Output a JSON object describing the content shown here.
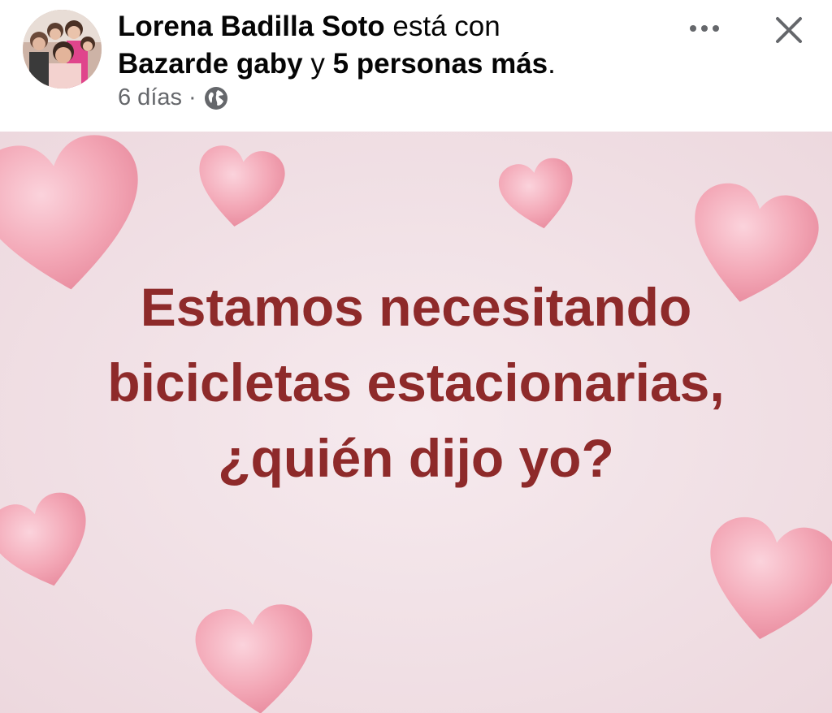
{
  "post": {
    "author": "Lorena Badilla Soto",
    "with_text": "está con",
    "tagged": "Bazarde gaby",
    "connector": "y",
    "others": "5 personas más",
    "period": ".",
    "time": "6 días",
    "separator": "·",
    "privacy_icon": "globe-icon",
    "image_text": "Estamos necesitando bicicletas estacionarias, ¿quién dijo yo?"
  },
  "icons": {
    "more": "more-options-icon",
    "close": "close-icon"
  },
  "colors": {
    "text_primary": "#050505",
    "text_secondary": "#65676b",
    "image_bg": "#f1e2e6",
    "image_text": "#8e2a2a",
    "heart": "#f3a7b6"
  }
}
